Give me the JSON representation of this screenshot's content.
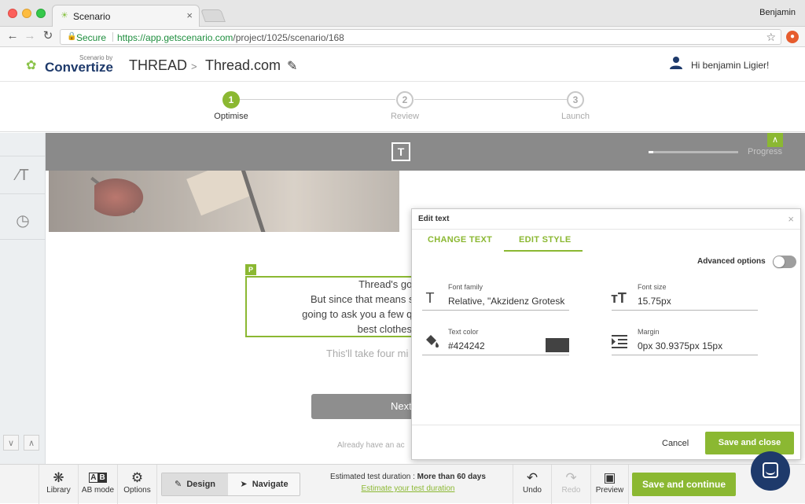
{
  "browser": {
    "tab_title": "Scenario",
    "profile_name": "Benjamin",
    "secure_label": "Secure",
    "url_prefix": "https://app.getscenario.com",
    "url_path": "/project/1025/scenario/168"
  },
  "header": {
    "logo_small": "Scenario by",
    "logo_main": "Convertize",
    "project_name": "THREAD",
    "separator": ">",
    "scenario_name": "Thread.com",
    "greeting": "Hi benjamin Ligier!"
  },
  "steps": [
    {
      "number": "1",
      "label": "Optimise",
      "active": true
    },
    {
      "number": "2",
      "label": "Review",
      "active": false
    },
    {
      "number": "3",
      "label": "Launch",
      "active": false
    }
  ],
  "canvas": {
    "logo_letter": "T",
    "progress_label": "Progress",
    "progress_fraction": 0.05,
    "text_tag": "P",
    "text_lines": [
      "Thread's goal is to he",
      "But since that means something",
      "going to ask you a few questions t",
      "best clothes"
    ],
    "sub_text": "This'll take four mi",
    "next_label": "Next",
    "already_text": "Already have an ac"
  },
  "edit_panel": {
    "title": "Edit text",
    "tabs": [
      "CHANGE TEXT",
      "EDIT STYLE"
    ],
    "active_tab": "EDIT STYLE",
    "advanced_label": "Advanced options",
    "advanced_on": false,
    "fields": {
      "font_family_label": "Font family",
      "font_family_value": "Relative, \"Akzidenz Grotesk",
      "font_size_label": "Font size",
      "font_size_value": "15.75px",
      "text_color_label": "Text color",
      "text_color_value": "#424242",
      "margin_label": "Margin",
      "margin_value": "0px 30.9375px 15px"
    },
    "cancel_label": "Cancel",
    "save_label": "Save and close"
  },
  "bottom_bar": {
    "library_label": "Library",
    "abmode_label": "AB mode",
    "options_label": "Options",
    "design_label": "Design",
    "navigate_label": "Navigate",
    "est_prefix": "Estimated test duration : ",
    "est_value": "More than 60 days",
    "est_link": "Estimate your test duration",
    "undo_label": "Undo",
    "redo_label": "Redo",
    "preview_label": "Preview",
    "save_continue_label": "Save and continue"
  },
  "colors": {
    "accent": "#8bb832",
    "brand_navy": "#1e3a6b",
    "text_color_swatch": "#424242"
  }
}
